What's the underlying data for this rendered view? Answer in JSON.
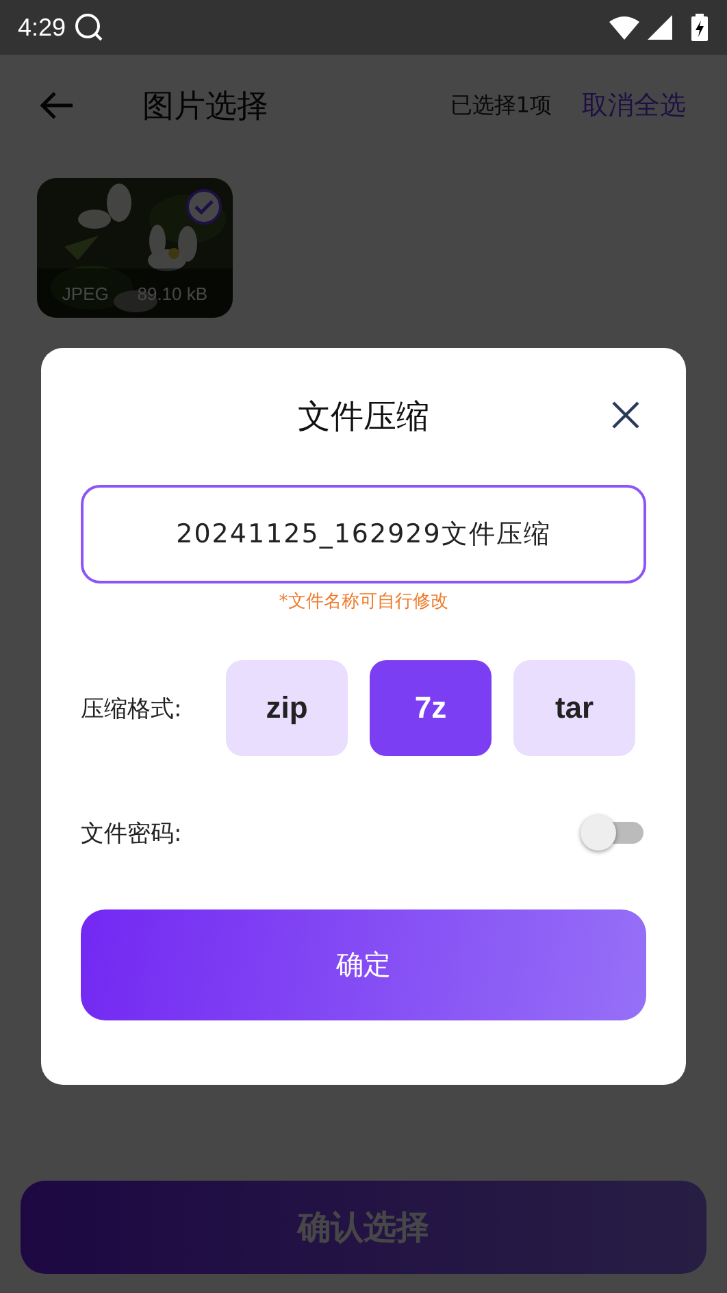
{
  "status_bar": {
    "time": "4:29"
  },
  "header": {
    "title": "图片选择",
    "selected_count": "已选择1项",
    "action": "取消全选"
  },
  "images": [
    {
      "format": "JPEG",
      "size": "89.10 kB",
      "selected": true
    }
  ],
  "dialog": {
    "title": "文件压缩",
    "filename": "20241125_162929文件压缩",
    "hint": "*文件名称可自行修改",
    "format_label": "压缩格式:",
    "formats": [
      {
        "label": "zip",
        "selected": false
      },
      {
        "label": "7z",
        "selected": true
      },
      {
        "label": "tar",
        "selected": false
      }
    ],
    "password_label": "文件密码:",
    "password_on": false,
    "confirm": "确定"
  },
  "bottom_button": "确认选择"
}
